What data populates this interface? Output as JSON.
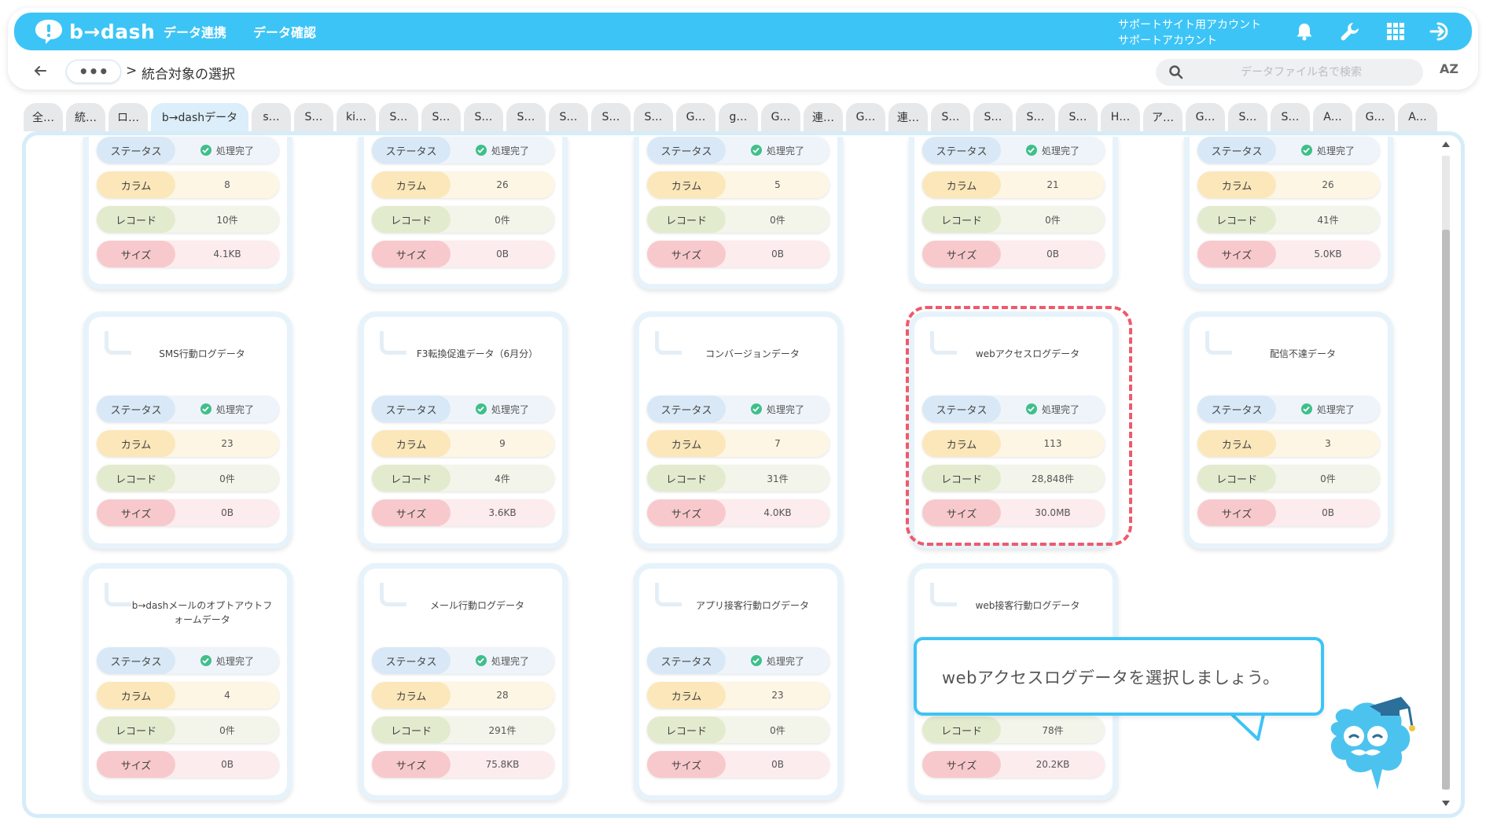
{
  "header": {
    "logo_text": "b→dash",
    "nav": [
      "データ連携",
      "データ確認"
    ],
    "account_line1": "サポートサイト用アカウント",
    "account_line2": "サポートアカウント"
  },
  "breadcrumb": {
    "more": "•••",
    "separator": ">",
    "title": "統合対象の選択"
  },
  "search": {
    "placeholder": "データファイル名で検索"
  },
  "sort_label": "AZ",
  "tabs": [
    "全…",
    "統…",
    "ロ…",
    "b→dashデータ",
    "s…",
    "S…",
    "ki…",
    "S…",
    "S…",
    "S…",
    "S…",
    "S…",
    "S…",
    "S…",
    "G…",
    "g…",
    "G…",
    "連…",
    "G…",
    "連…",
    "S…",
    "S…",
    "S…",
    "S…",
    "H…",
    "ア…",
    "G…",
    "S…",
    "S…",
    "A…",
    "G…",
    "A…"
  ],
  "active_tab": 3,
  "labels": {
    "status": "ステータス",
    "column": "カラム",
    "record": "レコード",
    "size": "サイズ"
  },
  "cards": [
    {
      "title": "",
      "status": "処理完了",
      "columns": "8",
      "records": "10件",
      "size": "4.1KB"
    },
    {
      "title": "",
      "status": "処理完了",
      "columns": "26",
      "records": "0件",
      "size": "0B"
    },
    {
      "title": "",
      "status": "処理完了",
      "columns": "5",
      "records": "0件",
      "size": "0B"
    },
    {
      "title": "",
      "status": "処理完了",
      "columns": "21",
      "records": "0件",
      "size": "0B"
    },
    {
      "title": "",
      "status": "処理完了",
      "columns": "26",
      "records": "41件",
      "size": "5.0KB"
    },
    {
      "title": "SMS行動ログデータ",
      "status": "処理完了",
      "columns": "23",
      "records": "0件",
      "size": "0B"
    },
    {
      "title": "F3転換促進データ（6月分）",
      "status": "処理完了",
      "columns": "9",
      "records": "4件",
      "size": "3.6KB"
    },
    {
      "title": "コンバージョンデータ",
      "status": "処理完了",
      "columns": "7",
      "records": "31件",
      "size": "4.0KB"
    },
    {
      "title": "webアクセスログデータ",
      "status": "処理完了",
      "columns": "113",
      "records": "28,848件",
      "size": "30.0MB"
    },
    {
      "title": "配信不達データ",
      "status": "処理完了",
      "columns": "3",
      "records": "0件",
      "size": "0B"
    },
    {
      "title": "b→dashメールのオプトアウトフォームデータ",
      "status": "処理完了",
      "columns": "4",
      "records": "0件",
      "size": "0B"
    },
    {
      "title": "メール行動ログデータ",
      "status": "処理完了",
      "columns": "28",
      "records": "291件",
      "size": "75.8KB"
    },
    {
      "title": "アプリ接客行動ログデータ",
      "status": "処理完了",
      "columns": "23",
      "records": "0件",
      "size": "0B"
    },
    {
      "title": "web接客行動ログデータ",
      "status": "",
      "columns": "",
      "records": "78件",
      "size": "20.2KB"
    }
  ],
  "tooltip": {
    "text": "webアクセスログデータを選択しましょう。"
  },
  "colors": {
    "brand": "#3dc4f6",
    "highlight": "#ef5a6b",
    "check": "#3fbf8a"
  }
}
